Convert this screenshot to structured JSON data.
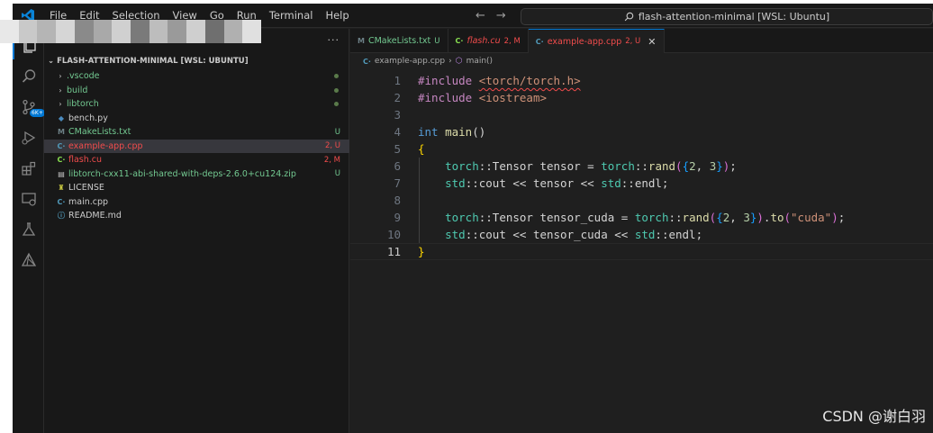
{
  "menu": [
    "File",
    "Edit",
    "Selection",
    "View",
    "Go",
    "Run",
    "Terminal",
    "Help"
  ],
  "search": {
    "text": "flash-attention-minimal [WSL: Ubuntu]"
  },
  "activity_badge": "6K+",
  "sidebar": {
    "more": "···",
    "root": "FLASH-ATTENTION-MINIMAL [WSL: UBUNTU]",
    "items": [
      {
        "name": ".vscode",
        "folder": true,
        "color": "#73c991",
        "icon": "",
        "icon_color": "",
        "status": "",
        "dot": true
      },
      {
        "name": "build",
        "folder": true,
        "color": "#73c991",
        "icon": "",
        "icon_color": "",
        "status": "",
        "dot": true
      },
      {
        "name": "libtorch",
        "folder": true,
        "color": "#73c991",
        "icon": "",
        "icon_color": "",
        "status": "",
        "dot": true
      },
      {
        "name": "bench.py",
        "folder": false,
        "color": "#cccccc",
        "icon": "◆",
        "icon_color": "#4b8bbe",
        "status": "",
        "dot": false
      },
      {
        "name": "CMakeLists.txt",
        "folder": false,
        "color": "#73c991",
        "icon": "M",
        "icon_color": "#6d8086",
        "status": "U",
        "status_color": "#73c991",
        "dot": false
      },
      {
        "name": "example-app.cpp",
        "folder": false,
        "color": "#f14c4c",
        "icon": "C·",
        "icon_color": "#519aba",
        "status": "2, U",
        "status_color": "#f14c4c",
        "dot": false,
        "selected": true
      },
      {
        "name": "flash.cu",
        "folder": false,
        "color": "#f14c4c",
        "icon": "C·",
        "icon_color": "#89e051",
        "status": "2, M",
        "status_color": "#f14c4c",
        "dot": false
      },
      {
        "name": "libtorch-cxx11-abi-shared-with-deps-2.6.0+cu124.zip",
        "folder": false,
        "color": "#73c991",
        "icon": "▤",
        "icon_color": "#c5c5c5",
        "status": "U",
        "status_color": "#73c991",
        "dot": false
      },
      {
        "name": "LICENSE",
        "folder": false,
        "color": "#cccccc",
        "icon": "♜",
        "icon_color": "#cbcb41",
        "status": "",
        "dot": false
      },
      {
        "name": "main.cpp",
        "folder": false,
        "color": "#cccccc",
        "icon": "C·",
        "icon_color": "#519aba",
        "status": "",
        "dot": false
      },
      {
        "name": "README.md",
        "folder": false,
        "color": "#cccccc",
        "icon": "ⓘ",
        "icon_color": "#519aba",
        "status": "",
        "dot": false
      }
    ]
  },
  "tabs": [
    {
      "label": "CMakeLists.txt",
      "icon": "M",
      "icon_color": "#6d8086",
      "label_color": "#73c991",
      "status": "U",
      "italic": false,
      "active": false
    },
    {
      "label": "flash.cu",
      "icon": "C·",
      "icon_color": "#89e051",
      "label_color": "#f14c4c",
      "status": "2, M",
      "italic": true,
      "active": false
    },
    {
      "label": "example-app.cpp",
      "icon": "C·",
      "icon_color": "#519aba",
      "label_color": "#f14c4c",
      "status": "2, U",
      "italic": false,
      "active": true
    }
  ],
  "tab_close": "✕",
  "breadcrumb": {
    "file": "example-app.cpp",
    "symbol": "main()"
  },
  "code": [
    {
      "n": "1",
      "tokens": [
        [
          "pre",
          "#include "
        ],
        [
          "str-sq",
          "<torch/torch.h>"
        ]
      ]
    },
    {
      "n": "2",
      "tokens": [
        [
          "pre",
          "#include "
        ],
        [
          "str",
          "<iostream>"
        ]
      ]
    },
    {
      "n": "3",
      "tokens": []
    },
    {
      "n": "4",
      "tokens": [
        [
          "kw",
          "int"
        ],
        [
          "txt",
          " "
        ],
        [
          "fn",
          "main"
        ],
        [
          "txt",
          "()"
        ]
      ]
    },
    {
      "n": "5",
      "tokens": [
        [
          "br1",
          "{"
        ]
      ]
    },
    {
      "n": "6",
      "indent": true,
      "tokens": [
        [
          "txt",
          "    "
        ],
        [
          "ns",
          "torch"
        ],
        [
          "txt",
          "::Tensor tensor = "
        ],
        [
          "ns",
          "torch"
        ],
        [
          "txt",
          "::"
        ],
        [
          "fn",
          "rand"
        ],
        [
          "br2",
          "("
        ],
        [
          "br3",
          "{"
        ],
        [
          "num",
          "2"
        ],
        [
          "txt",
          ", "
        ],
        [
          "num",
          "3"
        ],
        [
          "br3",
          "}"
        ],
        [
          "br2",
          ")"
        ],
        [
          "txt",
          ";"
        ]
      ]
    },
    {
      "n": "7",
      "indent": true,
      "tokens": [
        [
          "txt",
          "    "
        ],
        [
          "ns",
          "std"
        ],
        [
          "txt",
          "::cout << tensor << "
        ],
        [
          "ns",
          "std"
        ],
        [
          "txt",
          "::endl;"
        ]
      ]
    },
    {
      "n": "8",
      "indent": true,
      "tokens": []
    },
    {
      "n": "9",
      "indent": true,
      "tokens": [
        [
          "txt",
          "    "
        ],
        [
          "ns",
          "torch"
        ],
        [
          "txt",
          "::Tensor tensor_cuda = "
        ],
        [
          "ns",
          "torch"
        ],
        [
          "txt",
          "::"
        ],
        [
          "fn",
          "rand"
        ],
        [
          "br2",
          "("
        ],
        [
          "br3",
          "{"
        ],
        [
          "num",
          "2"
        ],
        [
          "txt",
          ", "
        ],
        [
          "num",
          "3"
        ],
        [
          "br3",
          "}"
        ],
        [
          "br2",
          ")"
        ],
        [
          "txt",
          "."
        ],
        [
          "fn",
          "to"
        ],
        [
          "br2",
          "("
        ],
        [
          "str",
          "\"cuda\""
        ],
        [
          "br2",
          ")"
        ],
        [
          "txt",
          ";"
        ]
      ]
    },
    {
      "n": "10",
      "indent": true,
      "tokens": [
        [
          "txt",
          "    "
        ],
        [
          "ns",
          "std"
        ],
        [
          "txt",
          "::cout << tensor_cuda << "
        ],
        [
          "ns",
          "std"
        ],
        [
          "txt",
          "::endl;"
        ]
      ]
    },
    {
      "n": "11",
      "current": true,
      "tokens": [
        [
          "br1",
          "}"
        ]
      ]
    }
  ],
  "watermark": "CSDN @谢白羽"
}
